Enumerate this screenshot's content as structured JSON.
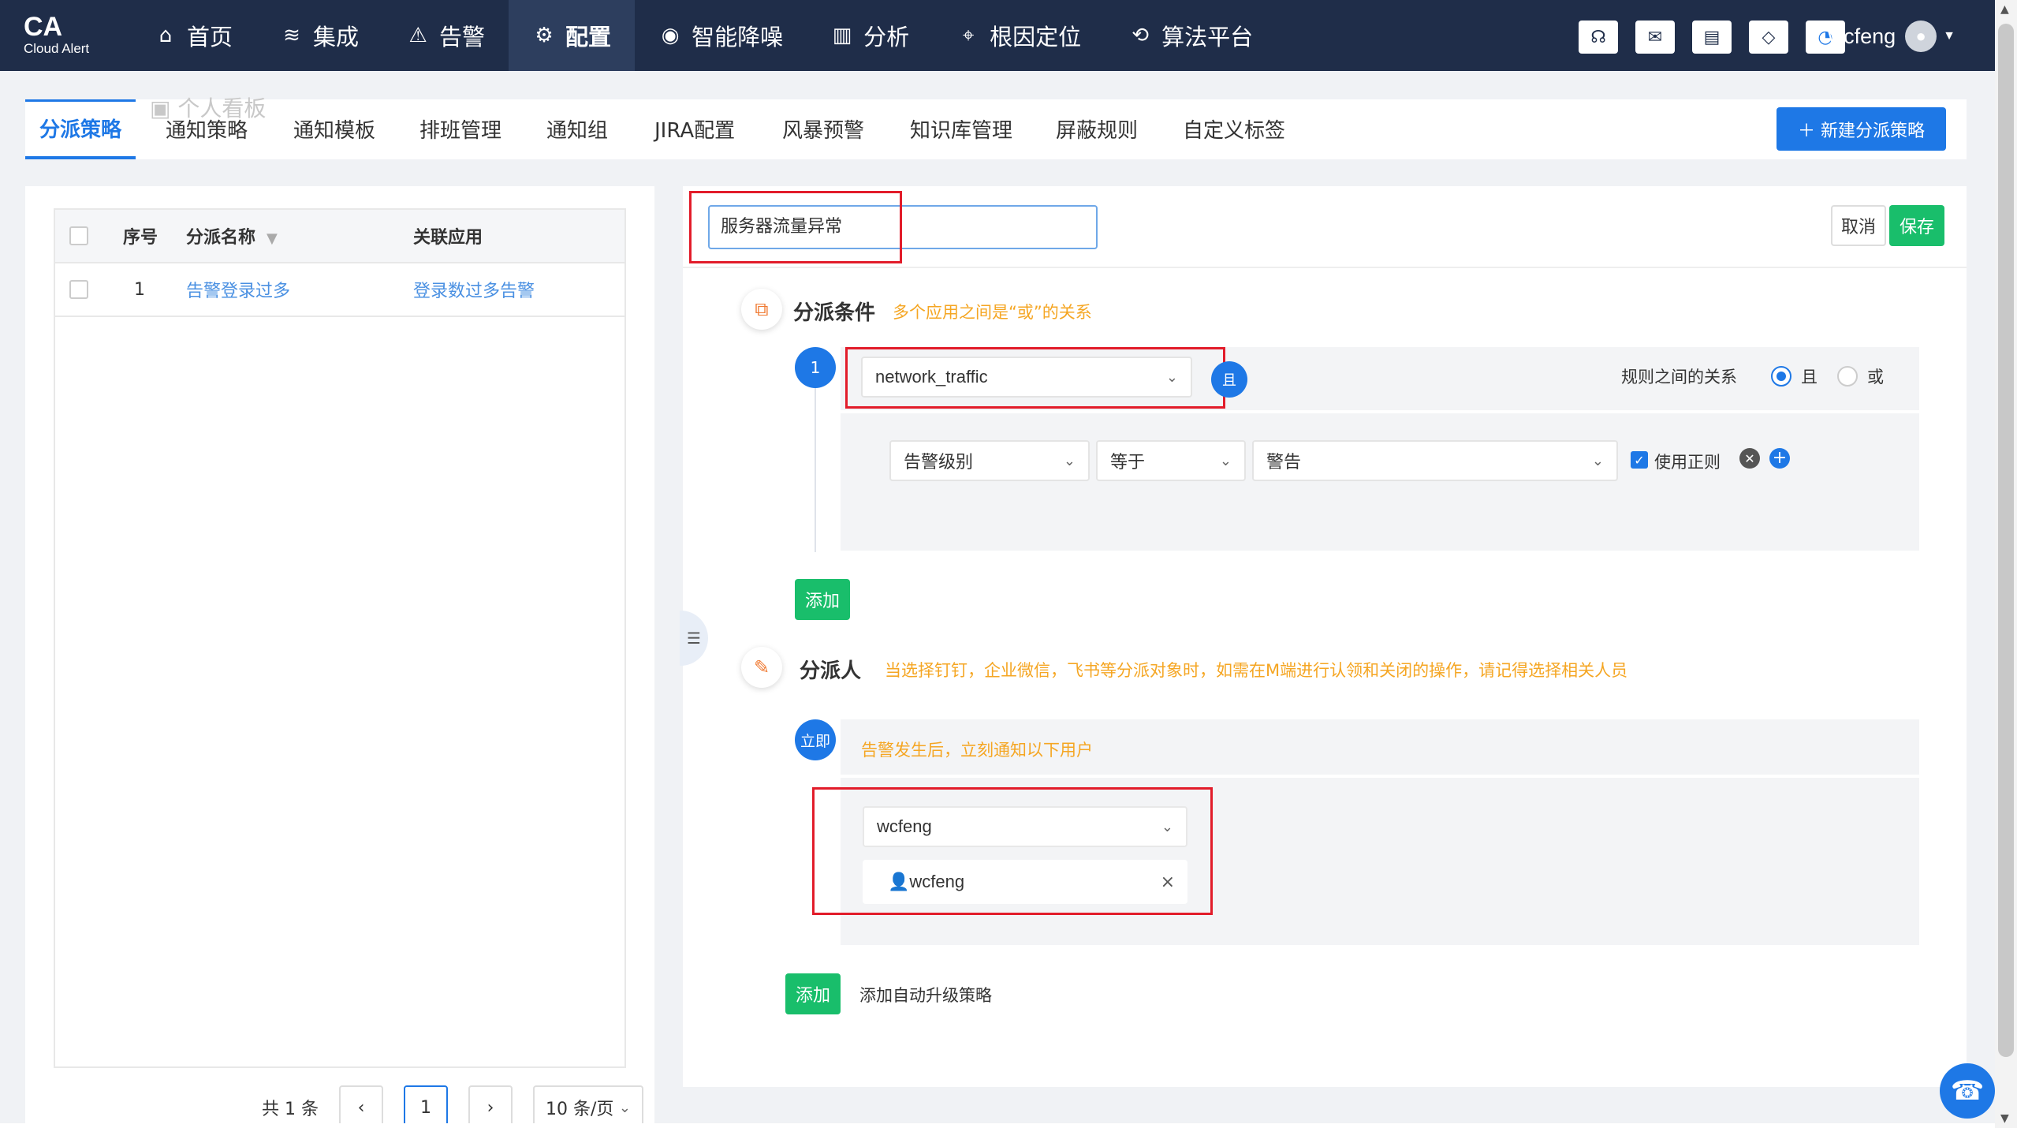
{
  "brand": {
    "title": "CA",
    "subtitle": "Cloud Alert"
  },
  "nav": [
    {
      "label": "首页",
      "icon": "home-icon",
      "glyph": "⌂"
    },
    {
      "label": "集成",
      "icon": "layers-icon",
      "glyph": "≋"
    },
    {
      "label": "告警",
      "icon": "alarm-light-icon",
      "glyph": "⚠"
    },
    {
      "label": "配置",
      "icon": "gear-icon",
      "glyph": "⚙"
    },
    {
      "label": "智能降噪",
      "icon": "noise-icon",
      "glyph": "◉"
    },
    {
      "label": "分析",
      "icon": "bar-chart-icon",
      "glyph": "▥"
    },
    {
      "label": "根因定位",
      "icon": "crosshair-icon",
      "glyph": "⌖"
    },
    {
      "label": "算法平台",
      "icon": "algorithm-icon",
      "glyph": "⟲"
    }
  ],
  "user": {
    "name": "wcfeng"
  },
  "tabs": {
    "ghost": "个人看板",
    "items": [
      "分派策略",
      "通知策略",
      "通知模板",
      "排班管理",
      "通知组",
      "JIRA配置",
      "风暴预警",
      "知识库管理",
      "屏蔽规则",
      "自定义标签"
    ],
    "new_button": "＋  新建分派策略"
  },
  "table": {
    "headers": {
      "no": "序号",
      "name": "分派名称",
      "app": "关联应用"
    },
    "rows": [
      {
        "no": "1",
        "name": "告警登录过多",
        "app": "登录数过多告警"
      }
    ]
  },
  "pagination": {
    "total": "共 1 条",
    "prev": "‹",
    "current": "1",
    "next": "›",
    "page_size": "10 条/页"
  },
  "editor": {
    "name_value": "服务器流量异常",
    "cancel": "取消",
    "save": "保存",
    "conditions": {
      "title": "分派条件",
      "note": "多个应用之间是“或”的关系",
      "index": "1",
      "app_select": "network_traffic",
      "and_badge": "且",
      "relation_label": "规则之间的关系",
      "radio_and": "且",
      "radio_or": "或",
      "rule_field": "告警级别",
      "rule_op": "等于",
      "rule_value": "警告",
      "use_regex": "使用正则",
      "add": "添加"
    },
    "assignee": {
      "title": "分派人",
      "note": "当选择钉钉，企业微信，飞书等分派对象时，如需在M端进行认领和关闭的操作，请记得选择相关人员",
      "badge": "立即",
      "head_note": "告警发生后，立刻通知以下用户",
      "user_select": "wcfeng",
      "user_tag": "wcfeng",
      "add": "添加",
      "auto_upgrade": "添加自动升级策略"
    }
  }
}
